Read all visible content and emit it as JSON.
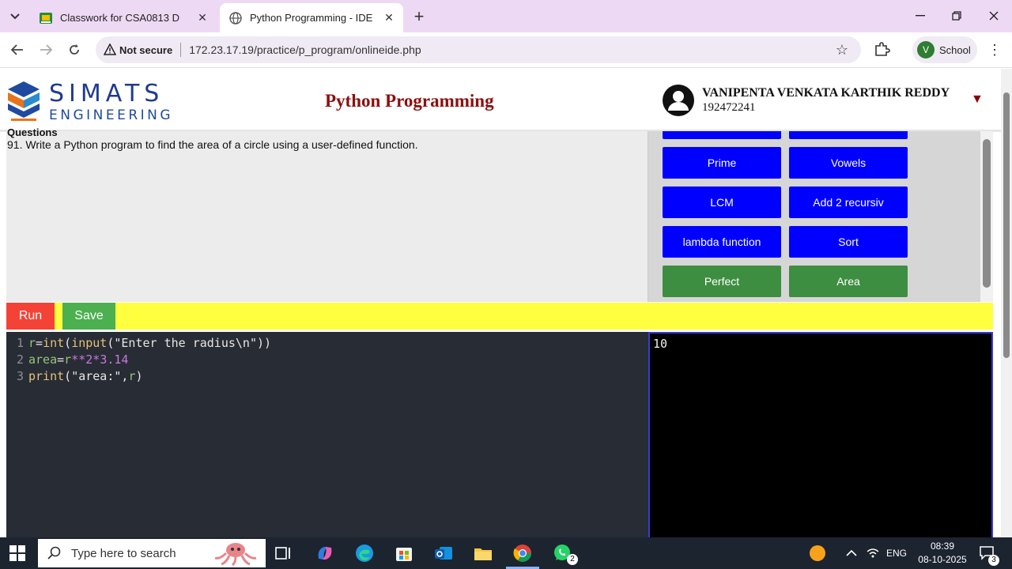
{
  "browser": {
    "tabs": [
      {
        "title": "Classwork for CSA0813 D",
        "active": false
      },
      {
        "title": "Python Programming - IDE",
        "active": true
      }
    ],
    "address": {
      "security_label": "Not secure",
      "url": "172.23.17.19/practice/p_program/onlineide.php"
    },
    "profile": {
      "initial": "V",
      "label": "School"
    }
  },
  "header": {
    "brand_top": "SIMATS",
    "brand_bottom": "ENGINEERING",
    "title": "Python Programming",
    "user_name": "VANIPENTA VENKATA KARTHIK REDDY",
    "user_id": "192472241"
  },
  "question": {
    "heading": "Questions",
    "text": "91. Write a Python program to find the area of a circle using a user-defined function."
  },
  "programs": [
    {
      "label": "Prime",
      "color": "#0000ff"
    },
    {
      "label": "Vowels",
      "color": "#0000ff"
    },
    {
      "label": "LCM",
      "color": "#0000ff"
    },
    {
      "label": "Add 2 recursiv",
      "color": "#0000ff"
    },
    {
      "label": "lambda function",
      "color": "#0000ff"
    },
    {
      "label": "Sort",
      "color": "#0000ff"
    },
    {
      "label": "Perfect",
      "color": "#3e8e41"
    },
    {
      "label": "Area",
      "color": "#3e8e41"
    }
  ],
  "actions": {
    "run": "Run",
    "save": "Save"
  },
  "editor": {
    "lines": [
      {
        "number": "1",
        "code": "r=int(input(\"Enter the radius\\n\"))"
      },
      {
        "number": "2",
        "code": "area=r**2*3.14"
      },
      {
        "number": "3",
        "code": "print(\"area:\",r)"
      }
    ]
  },
  "output": {
    "text": "10"
  },
  "taskbar": {
    "search_placeholder": "Type here to search",
    "language": "ENG",
    "time": "08:39",
    "date": "08-10-2025",
    "whatsapp_badge": "2",
    "notification_badge": "3"
  }
}
